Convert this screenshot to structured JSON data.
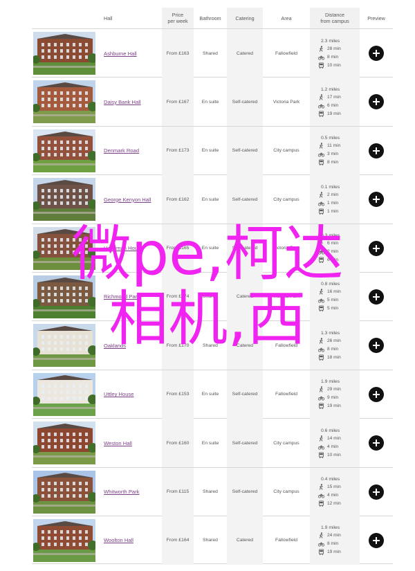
{
  "headers": {
    "hall": "Hall",
    "price_line1": "Price",
    "price_line2": "per week",
    "bathroom": "Bathroom",
    "catering": "Catering",
    "area": "Area",
    "distance_line1": "Distance",
    "distance_line2": "from campus",
    "preview": "Preview"
  },
  "rows": [
    {
      "name": "Ashburne Hall",
      "price": "From £163",
      "bathroom": "Shared",
      "catering": "Catered",
      "area": "Fallowfield",
      "miles": "2.3 miles",
      "walk": "28 min",
      "cycle": "8 min",
      "bus": "10 min",
      "photo": "brick-hall-lawn"
    },
    {
      "name": "Daisy Bank Hall",
      "price": "From £167",
      "bathroom": "En suite",
      "catering": "Self-catered",
      "area": "Victoria Park",
      "miles": "1.2 miles",
      "walk": "17 min",
      "cycle": "6 min",
      "bus": "19 min",
      "photo": "brick-block-courtyard"
    },
    {
      "name": "Denmark Road",
      "price": "From £173",
      "bathroom": "En suite",
      "catering": "Self-catered",
      "area": "City campus",
      "miles": "0.5 miles",
      "walk": "11 min",
      "cycle": "3 min",
      "bus": "8 min",
      "photo": "modern-block-lawn"
    },
    {
      "name": "George Kenyon Hall",
      "price": "From £162",
      "bathroom": "En suite",
      "catering": "Self-catered",
      "area": "City campus",
      "miles": "0.1 miles",
      "walk": "2 min",
      "cycle": "1 min",
      "bus": "1 min",
      "photo": "tall-tower"
    },
    {
      "name": "Horniman House",
      "price": "From £165",
      "bathroom": "En suite",
      "catering": "Self-catered",
      "area": "Victoria Park",
      "miles": "0.3 miles",
      "walk": "6 min",
      "cycle": "2 min",
      "bus": "6 min",
      "photo": "victorian-house"
    },
    {
      "name": "Richmond Park",
      "price": "From £174",
      "bathroom": "Shared",
      "catering": "Catered",
      "area": "Victoria Park",
      "miles": "0.8 miles",
      "walk": "16 min",
      "cycle": "5 min",
      "bus": "5 min",
      "photo": "trees-park"
    },
    {
      "name": "Oaklands",
      "price": "From £170",
      "bathroom": "Shared",
      "catering": "Catered",
      "area": "Fallowfield",
      "miles": "1.3 miles",
      "walk": "26 min",
      "cycle": "8 min",
      "bus": "18 min",
      "photo": "white-villa"
    },
    {
      "name": "Uttley House",
      "price": "From £153",
      "bathroom": "En suite",
      "catering": "Self-catered",
      "area": "Fallowfield",
      "miles": "1.9 miles",
      "walk": "29 min",
      "cycle": "9 min",
      "bus": "19 min",
      "photo": "white-house-lawn"
    },
    {
      "name": "Weston Hall",
      "price": "From £160",
      "bathroom": "En suite",
      "catering": "Self-catered",
      "area": "City campus",
      "miles": "0.6 miles",
      "walk": "14 min",
      "cycle": "4 min",
      "bus": "10 min",
      "photo": "brick-blocks"
    },
    {
      "name": "Whitworth Park",
      "price": "From £115",
      "bathroom": "Shared",
      "catering": "Self-catered",
      "area": "City campus",
      "miles": "0.4 miles",
      "walk": "15 min",
      "cycle": "4 min",
      "bus": "12 min",
      "photo": "terraced-flats"
    },
    {
      "name": "Woolton Hall",
      "price": "From £164",
      "bathroom": "Shared",
      "catering": "Catered",
      "area": "Fallowfield",
      "miles": "1.9 miles",
      "walk": "24 min",
      "cycle": "8 min",
      "bus": "19 min",
      "photo": "low-brick-hall"
    }
  ],
  "watermark": {
    "line1": "微pe,柯达",
    "line2": "相机,西"
  },
  "colors": {
    "link": "#7a3f85",
    "watermark": "#f023f0",
    "shade": "#f3f3f3",
    "preview_button": "#111111"
  }
}
